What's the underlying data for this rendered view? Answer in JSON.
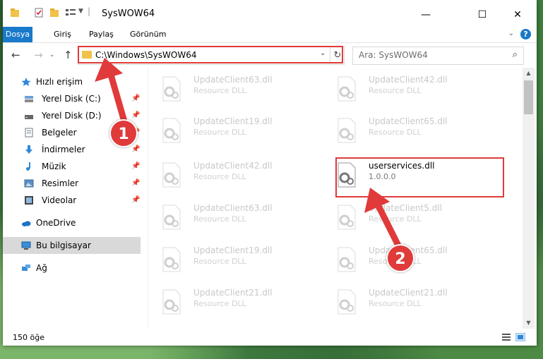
{
  "window": {
    "title": "SysWOW64",
    "controls": {
      "minimize": "—",
      "maximize": "☐",
      "close": "✕"
    }
  },
  "ribbon": {
    "tabs": [
      "Dosya",
      "Giriş",
      "Paylaş",
      "Görünüm"
    ],
    "help": "?"
  },
  "address": {
    "path": "C:\\Windows\\SysWOW64",
    "search_placeholder": "Ara: SysWOW64"
  },
  "nav_pane": {
    "quick_access": "Hızlı erişim",
    "items": [
      {
        "label": "Yerel Disk (C:)",
        "icon": "drive-icon",
        "pinned": true
      },
      {
        "label": "Yerel Disk (D:)",
        "icon": "drive-icon",
        "pinned": true
      },
      {
        "label": "Belgeler",
        "icon": "documents-icon",
        "pinned": true
      },
      {
        "label": "İndirmeler",
        "icon": "download-icon",
        "pinned": true
      },
      {
        "label": "Müzik",
        "icon": "music-icon",
        "pinned": true
      },
      {
        "label": "Resimler",
        "icon": "pictures-icon",
        "pinned": true
      },
      {
        "label": "Videolar",
        "icon": "videos-icon",
        "pinned": true
      }
    ],
    "onedrive": "OneDrive",
    "this_pc": "Bu bilgisayar",
    "network": "Ağ"
  },
  "files": {
    "left": [
      {
        "name": "UpdateClient63.dll",
        "type": "Resource DLL"
      },
      {
        "name": "UpdateClient19.dll",
        "type": "Resource DLL"
      },
      {
        "name": "UpdateClient42.dll",
        "type": "Resource DLL"
      },
      {
        "name": "UpdateClient63.dll",
        "type": "Resource DLL"
      },
      {
        "name": "UpdateClient19.dll",
        "type": "Resource DLL"
      },
      {
        "name": "UpdateClient21.dll",
        "type": "Resource DLL"
      }
    ],
    "right": [
      {
        "name": "UpdateClient42.dll",
        "type": "Resource DLL"
      },
      {
        "name": "UpdateClient65.dll",
        "type": "Resource DLL"
      },
      {
        "name": "userservices.dll",
        "type": "1.0.0.0"
      },
      {
        "name": "UpdateClient5.dll",
        "type": "Resource DLL"
      },
      {
        "name": "UpdateClient65.dll",
        "type": "Resource DLL"
      },
      {
        "name": "UpdateClient21.dll",
        "type": "Resource DLL"
      }
    ]
  },
  "status": {
    "count": "150 öğe"
  },
  "annotations": {
    "badge1": "1",
    "badge2": "2",
    "color": "#e03a3a"
  }
}
